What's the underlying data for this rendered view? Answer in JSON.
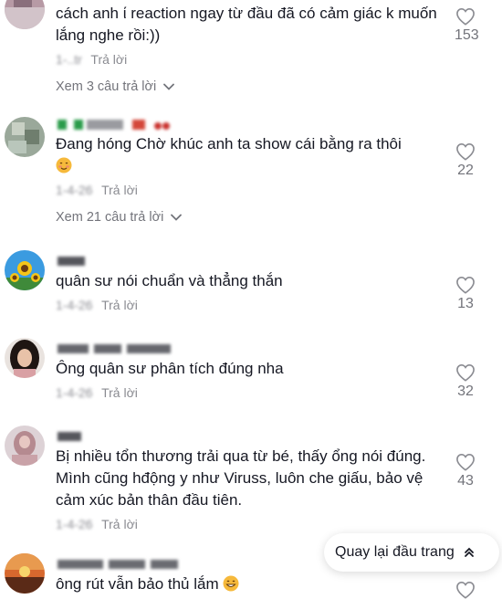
{
  "comments": [
    {
      "username": "",
      "text": "cách anh ί reaction ngay từ đầu đã có cảm giác k muốn lắng nghe rồi:))",
      "date": "1-… tr...",
      "reply_label": "Trả lời",
      "likes": "153",
      "view_replies": "Xem 3 câu trả lời"
    },
    {
      "username": "",
      "text": "Đang hóng Chờ khúc anh ta show cái bằng ra thôi",
      "date": "",
      "reply_label": "Trả lời",
      "likes": "22",
      "view_replies": "Xem 21 câu trả lời"
    },
    {
      "username": "",
      "text": "quân sư nói chuẩn và thẳng thắn",
      "date": "",
      "reply_label": "Trả lời",
      "likes": "13"
    },
    {
      "username": "",
      "text": "Ông quân sư phân tích đúng nha",
      "date": "",
      "reply_label": "Trả lời",
      "likes": "32"
    },
    {
      "username": "",
      "text": "Bị nhiều tổn thương trải qua từ bé, thấy ổng nói đúng. Mình cũng hđộng y như Viruss, luôn che giấu, bảo vệ cảm xúc bản thân đầu tiên.",
      "date": "",
      "reply_label": "Trả lời",
      "likes": "43"
    },
    {
      "username": "",
      "text": "ông rút vẫn bảo thủ lắm",
      "date": "",
      "reply_label": "",
      "likes": ""
    }
  ],
  "scroll_top_label": "Quay lại đầu trang",
  "colors": {
    "text": "#161823",
    "muted": "#73747b",
    "heart": "#8a8b91"
  }
}
